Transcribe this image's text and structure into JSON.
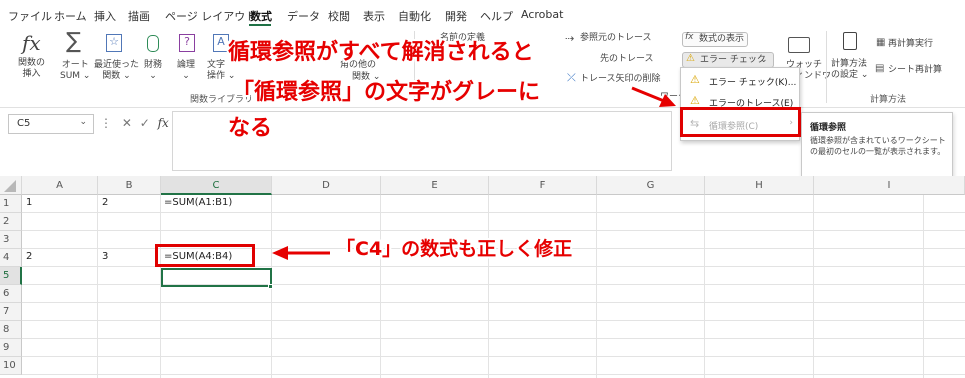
{
  "menu": {
    "tabs": [
      "ファイル",
      "ホーム",
      "挿入",
      "描画",
      "ページ レイアウト",
      "数式",
      "データ",
      "校閲",
      "表示",
      "自動化",
      "開発",
      "ヘルプ",
      "Acrobat"
    ],
    "active_tab": "数式"
  },
  "ribbon": {
    "insert_function": "関数の\n挿入",
    "autosum": "オート\nSUM ⌄",
    "recent": "最近使った\n関数 ⌄",
    "financial": "財務\n⌄",
    "logical": "論理\n⌄",
    "text": "文字\n操作 ⌄",
    "group_function_library": "関数ライブラリ",
    "defined_name_fragment_1": "角の他の",
    "defined_name_fragment_2": "関数 ⌄",
    "name_manager_fragment": "名前の定義",
    "trace_precedents": "参照元のトレース",
    "trace_dependents": "先のトレース",
    "remove_arrows": "トレース矢印の削除",
    "show_formulas": "数式の表示",
    "error_check": "エラー チェック",
    "watch_window": "ウォッチ\nウィンドウ",
    "calc_options": "計算方法\nの設定 ⌄",
    "calc_now": "再計算実行",
    "calc_sheet": "シート再計算",
    "group_calc": "計算方法",
    "group_auditing_fragment": "ワーク"
  },
  "dropdown": {
    "error_check_item": "エラー チェック(K)...",
    "trace_error_item": "エラーのトレース(E)",
    "circular_item": "循環参照(C)"
  },
  "tooltip": {
    "title": "循環参照",
    "body": "循環参照が含まれているワークシートの最初のセルの一覧が表示されます。"
  },
  "formula_bar": {
    "name_box": "C5",
    "cancel": "✕",
    "enter": "✓",
    "fx": "fx"
  },
  "sheet": {
    "columns": [
      "A",
      "B",
      "C",
      "D",
      "E",
      "F",
      "G",
      "H",
      "I"
    ],
    "selected_column": "C",
    "rows": [
      "1",
      "2",
      "3",
      "4",
      "5",
      "6",
      "7",
      "8",
      "9",
      "10"
    ],
    "selected_row": "5",
    "cells": {
      "A1": "1",
      "B1": "2",
      "C1": "=SUM(A1:B1)",
      "A4": "2",
      "B4": "3",
      "C4": "=SUM(A4:B4)"
    }
  },
  "annotations": {
    "line1": "循環参照がすべて解消されると",
    "line2": "「循環参照」の文字がグレーに",
    "line3": "なる",
    "line4": "「C4」の数式も正しく修正"
  },
  "colors": {
    "excel_green": "#217346",
    "annotation_red": "#e60000"
  }
}
